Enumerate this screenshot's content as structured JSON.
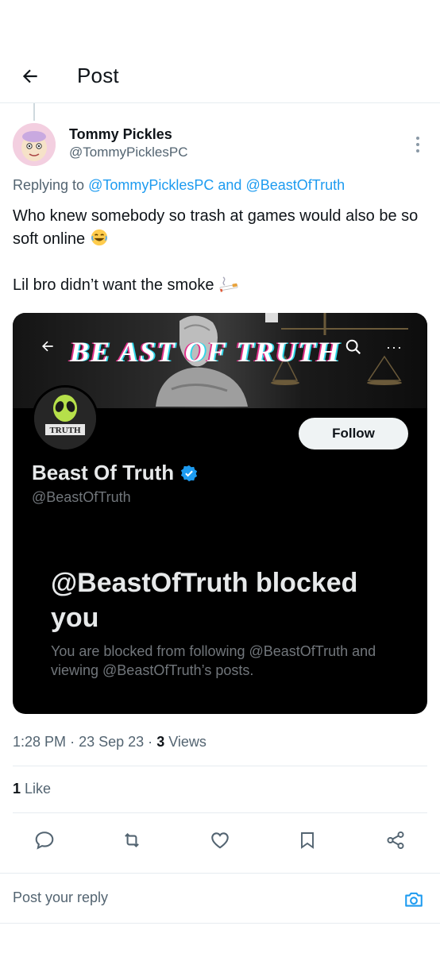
{
  "header": {
    "title": "Post"
  },
  "tweet": {
    "author_name": "Tommy Pickles",
    "author_handle": "@TommyPicklesPC",
    "replying_prefix": "Replying to",
    "replying_user1": "@TommyPicklesPC",
    "replying_and": "and",
    "replying_user2": "@BeastOfTruth",
    "text_line1": "Who knew somebody so trash at games would also be so soft online",
    "text_line2": "Lil bro didn’t want the smoke",
    "emoji1": "face-with-tears-of-joy",
    "emoji2": "cigarette"
  },
  "media": {
    "banner_text": "BE AST OF TRUTH",
    "avatar_text": "TRUTH",
    "follow_label": "Follow",
    "profile_name": "Beast Of Truth",
    "profile_handle": "@BeastOfTruth",
    "blocked_title": "@BeastOfTruth blocked you",
    "blocked_desc": "You are blocked from following @BeastOfTruth and viewing @BeastOfTruth’s posts."
  },
  "meta": {
    "time": "1:28 PM",
    "sep": "·",
    "date": "23 Sep 23",
    "views_count": "3",
    "views_label": "Views"
  },
  "likes": {
    "count": "1",
    "label": "Like"
  },
  "actions": [
    "reply-icon",
    "retweet-icon",
    "like-icon",
    "bookmark-icon",
    "share-icon"
  ],
  "reply": {
    "placeholder": "Post your reply"
  },
  "colors": {
    "accent": "#1d9bf0",
    "text": "#0f1419",
    "muted": "#536471",
    "verified": "#1d9bf0"
  }
}
